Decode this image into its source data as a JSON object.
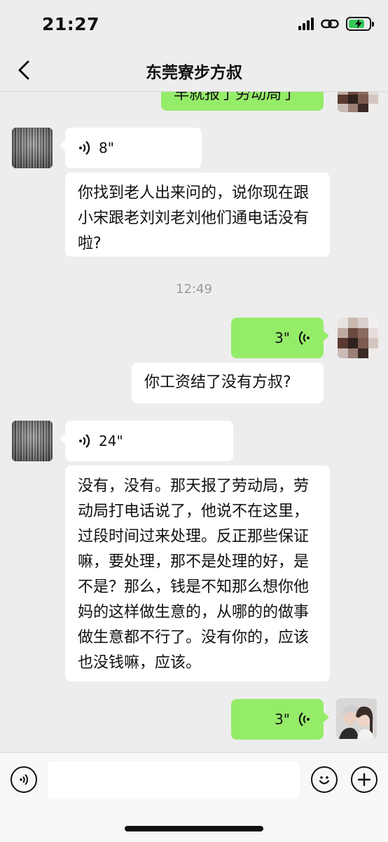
{
  "status": {
    "time": "21:27"
  },
  "header": {
    "title": "东莞寮步方叔"
  },
  "messages": {
    "partial_top": "早就报了劳动局了",
    "voice1": "8\"",
    "text1": "你找到老人出来问的，说你现在跟小宋跟老刘刘老刘他们通电话没有啦?",
    "timestamp": "12:49",
    "voice2": "3\"",
    "text2": "你工资结了没有方叔?",
    "voice3": "24\"",
    "text3": "没有，没有。那天报了劳动局，劳动局打电话说了，他说不在这里，过段时间过来处理。反正那些保证嘛，要处理，那不是处理的好，是不是？那么，钱是不知那么想你他妈的这样做生意的，从哪的的做事做生意都不行了。没有你的，应该也没钱嘛，应该。",
    "voice4": "3\""
  },
  "input": {
    "placeholder": ""
  },
  "icons": {
    "back": "chevron-left-icon",
    "voice_toggle": "voice-icon",
    "emoji": "emoji-icon",
    "more": "plus-icon"
  },
  "colors": {
    "bg": "#EDEDED",
    "self_bubble": "#95EC69",
    "other_bubble": "#FFFFFF"
  }
}
